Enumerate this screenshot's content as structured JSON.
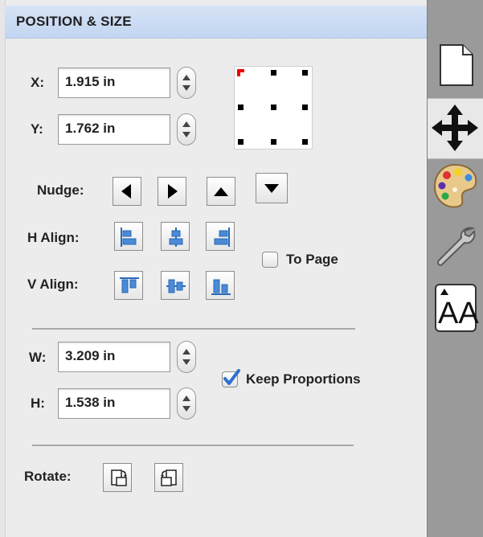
{
  "header": {
    "title": "POSITION & SIZE"
  },
  "position": {
    "x_label": "X:",
    "x_value": "1.915 in",
    "y_label": "Y:",
    "y_value": "1.762 in"
  },
  "nudge": {
    "label": "Nudge:"
  },
  "align": {
    "h_label": "H Align:",
    "v_label": "V Align:",
    "to_page_label": "To Page",
    "to_page_checked": false
  },
  "size": {
    "w_label": "W:",
    "w_value": "3.209 in",
    "h_label": "H:",
    "h_value": "1.538 in",
    "keep_proportions_label": "Keep Proportions",
    "keep_proportions_checked": true
  },
  "rotate": {
    "label": "Rotate:"
  },
  "sidebar": {
    "items": [
      "document-icon",
      "move-arrows-icon",
      "palette-icon",
      "wrench-icon",
      "text-size-icon"
    ],
    "active": "move-arrows-icon",
    "text_icon_glyph": "AA"
  },
  "colors": {
    "header": "#c9daf3",
    "accent_check": "#2f6fcf",
    "anchor_selected": "#e00000"
  }
}
